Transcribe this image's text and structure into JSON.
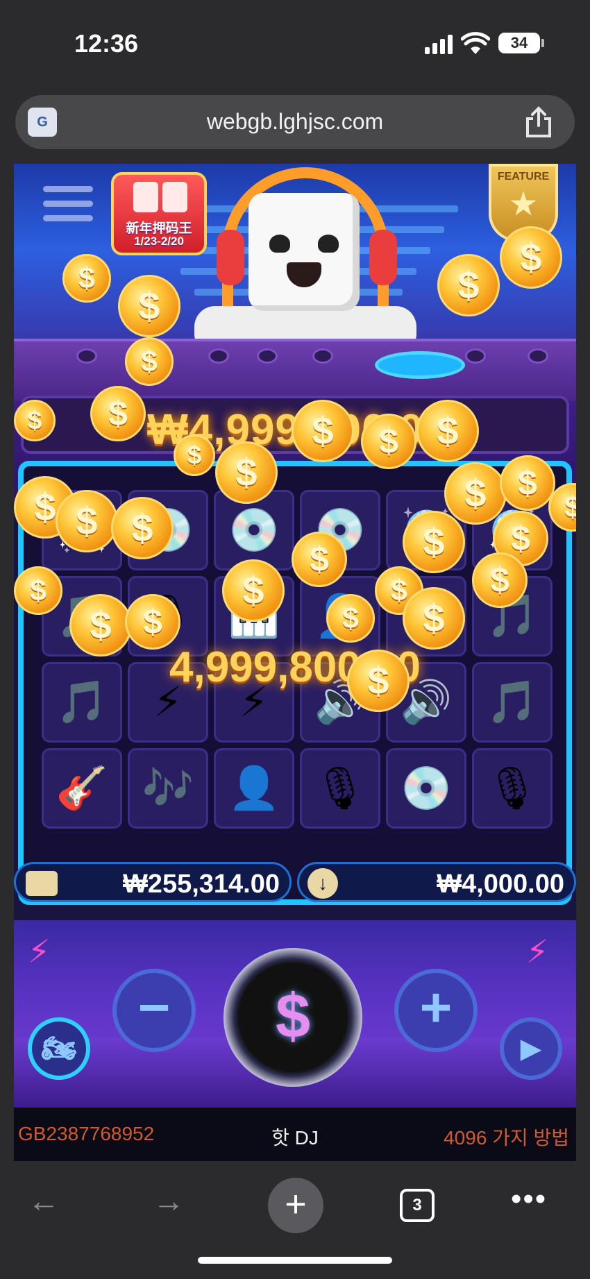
{
  "status_bar": {
    "time": "12:36",
    "battery": "34"
  },
  "browser": {
    "url": "webgb.lghjsc.com",
    "translate_icon": "translate-icon",
    "share_icon": "share-icon"
  },
  "game": {
    "event_badge": {
      "title": "新年押码王",
      "dates": "1/23-2/20"
    },
    "feature_label": "FEATURE",
    "jackpot_display": "₩4,999,800.00",
    "win_amount": "4,999,800.00",
    "balance": "₩255,314.00",
    "bet": "₩4,000.00",
    "footer": {
      "game_id": "GB2387768952",
      "game_name": "핫 DJ",
      "ways": "4096 가지 방법"
    },
    "reels": [
      [
        "🪩",
        "💿",
        "💿",
        "💿",
        "🪩",
        "🪩"
      ],
      [
        "🎵",
        "🎙",
        "🎹",
        "👤",
        "🎵",
        "🎵"
      ],
      [
        "🎵",
        "⚡",
        "⚡",
        "🔊",
        "🔊",
        "🎵"
      ],
      [
        "🎸",
        "🎶",
        "👤",
        "🎙",
        "💿",
        "🎙"
      ]
    ]
  },
  "toolbar": {
    "back": "←",
    "forward": "→",
    "new_tab": "+",
    "tab_count": "3",
    "more": "•••"
  }
}
